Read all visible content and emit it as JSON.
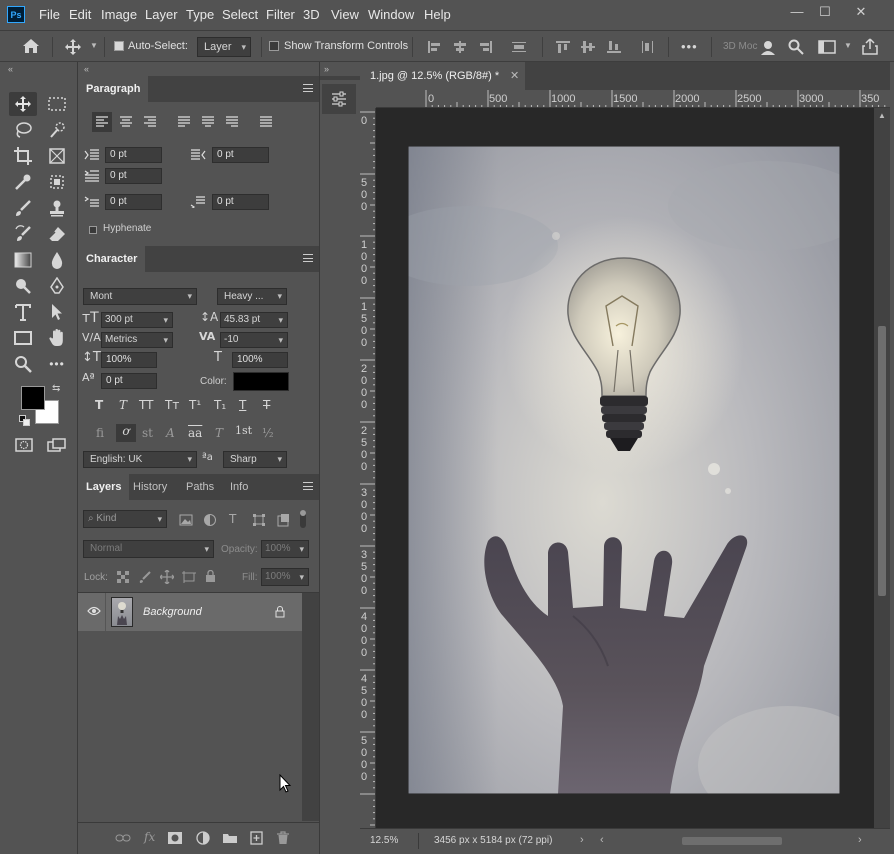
{
  "menubar": {
    "logo": "Ps",
    "items": [
      "File",
      "Edit",
      "Image",
      "Layer",
      "Type",
      "Select",
      "Filter",
      "3D",
      "View",
      "Window",
      "Help"
    ],
    "window_controls": [
      "—",
      "☐",
      "✕"
    ]
  },
  "options": {
    "auto_select_label": "Auto-Select:",
    "auto_select_checked": true,
    "auto_select_target": "Layer",
    "show_transform_label": "Show Transform Controls",
    "show_transform_checked": false,
    "more": "•••",
    "mode_3d": "3D Moc"
  },
  "paragraph": {
    "tab": "Paragraph",
    "indent_left": "0 pt",
    "indent_right": "0 pt",
    "indent_first": "0 pt",
    "space_before": "0 pt",
    "space_after": "0 pt",
    "hyphenate_label": "Hyphenate"
  },
  "character": {
    "tab": "Character",
    "font_family": "Mont",
    "font_style": "Heavy ...",
    "font_size": "300 pt",
    "leading": "45.83 pt",
    "kerning": "Metrics",
    "tracking": "-10",
    "vertical_scale": "100%",
    "horizontal_scale": "100%",
    "baseline_shift": "0 pt",
    "color_label": "Color:",
    "text_color": "#000000",
    "language": "English: UK",
    "antialias": "Sharp",
    "aa_symbol": "ªa",
    "style_buttons": [
      "T",
      "T",
      "TT",
      "Tт",
      "T¹",
      "T₁",
      "T",
      "T"
    ],
    "opentype_buttons": [
      "fi",
      "ơ",
      "st",
      "A",
      "aa",
      "T",
      "1st",
      "½"
    ]
  },
  "layers": {
    "tabs": [
      "Layers",
      "History",
      "Paths",
      "Info"
    ],
    "filter_placeholder": "Kind",
    "blend_mode": "Normal",
    "opacity_label": "Opacity:",
    "opacity_value": "100%",
    "lock_label": "Lock:",
    "fill_label": "Fill:",
    "fill_value": "100%",
    "rows": [
      {
        "name": "Background",
        "visible": true,
        "locked": true
      }
    ]
  },
  "document": {
    "tab_title": "1.jpg @ 12.5% (RGB/8#) *",
    "ruler_h": [
      "0",
      "500",
      "1000",
      "1500",
      "2000",
      "2500",
      "3000",
      "350"
    ],
    "ruler_v": [
      "0",
      "500",
      "1000",
      "1500",
      "2000",
      "2500",
      "3000",
      "3500",
      "4000",
      "4500",
      "5000"
    ],
    "zoom": "12.5%",
    "doc_info": "3456 px x 5184 px (72 ppi)"
  },
  "colors": {
    "foreground": "#000000",
    "background": "#ffffff",
    "accent": "#31a8ff"
  }
}
